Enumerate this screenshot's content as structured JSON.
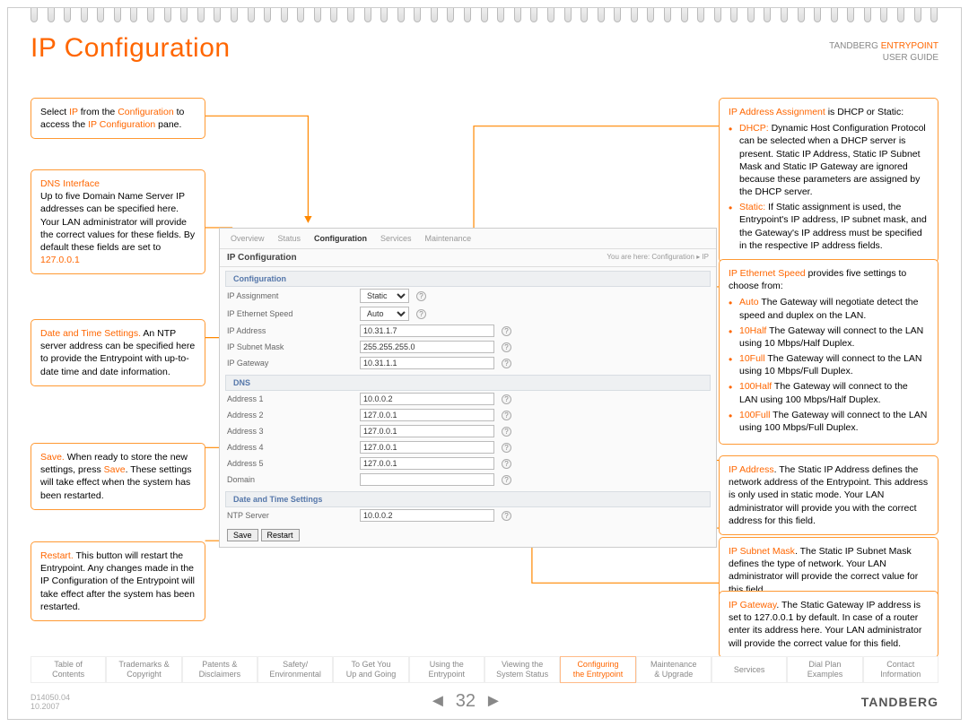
{
  "header": {
    "title": "IP Configuration",
    "brand_a": "TANDBERG",
    "brand_b": "ENTRYPOINT",
    "brand_c": "USER GUIDE"
  },
  "left1": {
    "t1": "Select ",
    "t2": "IP",
    "t3": " from the ",
    "t4": "Configuration",
    "t5": " to access the ",
    "t6": "IP Configuration",
    "t7": " pane."
  },
  "left2": {
    "h": "DNS Interface",
    "t": "Up to five Domain Name Server IP addresses can be specified here. Your LAN administrator will provide the correct values for these fields. By default these fields are set to ",
    "v": "127.0.0.1"
  },
  "left3": {
    "h": "Date and Time Settings.",
    "t": " An NTP server address can be specified here to provide the Entrypoint with up-to-date time and date information."
  },
  "left4": {
    "h": "Save.",
    "t1": " When ready to store the new settings, press ",
    "h2": "Save",
    "t2": ". These settings will take effect when the system has been restarted."
  },
  "left5": {
    "h": "Restart.",
    "t": " This button will restart the Entrypoint. Any changes made in the IP Configuration of the Entrypoint will take effect after the system has been restarted."
  },
  "right1": {
    "h": "IP Address Assignment",
    "t": " is DHCP or Static:",
    "li": [
      {
        "h": "DHCP:",
        "t": " Dynamic Host Configuration Protocol can be selected when a DHCP server is present. Static IP Address, Static IP Subnet Mask and Static IP Gateway are ignored because these parameters are assigned by the DHCP server."
      },
      {
        "h": "Static:",
        "t": " If Static assignment is used, the Entrypoint's IP address, IP subnet mask, and the Gateway's IP address must be specified in the respective IP address fields."
      }
    ]
  },
  "right2": {
    "h": "IP Ethernet Speed",
    "t": " provides five settings to choose from:",
    "li": [
      {
        "h": "Auto",
        "t": " The Gateway will negotiate detect the speed and duplex on the LAN."
      },
      {
        "h": "10Half",
        "t": " The Gateway will connect to the LAN using 10 Mbps/Half Duplex."
      },
      {
        "h": "10Full",
        "t": " The Gateway will connect to the LAN using 10 Mbps/Full Duplex."
      },
      {
        "h": "100Half",
        "t": " The Gateway will connect to the LAN using 100 Mbps/Half Duplex."
      },
      {
        "h": "100Full",
        "t": " The Gateway will connect to the LAN using 100 Mbps/Full Duplex."
      }
    ]
  },
  "right3": {
    "h": "IP Address",
    "t": ". The Static IP Address defines the network address of the Entrypoint. This address is only used in static mode. Your LAN administrator will provide you with the correct address for this field."
  },
  "right4": {
    "h": "IP Subnet Mask",
    "t": ". The Static IP Subnet Mask defines the type of network. Your LAN administrator will provide the correct value for this field."
  },
  "right5": {
    "h": "IP Gateway",
    "t": ". The Static Gateway IP address is set to 127.0.0.1 by default. In case of a router enter its address here. Your LAN administrator will provide the correct value for this field."
  },
  "shot": {
    "tabs": [
      "Overview",
      "Status",
      "Configuration",
      "Services",
      "Maintenance"
    ],
    "active": "Configuration",
    "pane_title": "IP Configuration",
    "breadcrumb": "You are here: Configuration ▸ IP",
    "sects": [
      {
        "title": "Configuration",
        "rows": [
          {
            "label": "IP Assignment",
            "type": "select",
            "value": "Static"
          },
          {
            "label": "IP Ethernet Speed",
            "type": "select",
            "value": "Auto"
          },
          {
            "label": "IP Address",
            "type": "text",
            "value": "10.31.1.7"
          },
          {
            "label": "IP Subnet Mask",
            "type": "text",
            "value": "255.255.255.0"
          },
          {
            "label": "IP Gateway",
            "type": "text",
            "value": "10.31.1.1"
          }
        ]
      },
      {
        "title": "DNS",
        "rows": [
          {
            "label": "Address 1",
            "type": "text",
            "value": "10.0.0.2"
          },
          {
            "label": "Address 2",
            "type": "text",
            "value": "127.0.0.1"
          },
          {
            "label": "Address 3",
            "type": "text",
            "value": "127.0.0.1"
          },
          {
            "label": "Address 4",
            "type": "text",
            "value": "127.0.0.1"
          },
          {
            "label": "Address 5",
            "type": "text",
            "value": "127.0.0.1"
          },
          {
            "label": "Domain",
            "type": "text",
            "value": ""
          }
        ]
      },
      {
        "title": "Date and Time Settings",
        "rows": [
          {
            "label": "NTP Server",
            "type": "text",
            "value": "10.0.0.2"
          }
        ]
      }
    ],
    "btns": [
      "Save",
      "Restart"
    ]
  },
  "toc": [
    {
      "a": "Table of",
      "b": "Contents"
    },
    {
      "a": "Trademarks &",
      "b": "Copyright"
    },
    {
      "a": "Patents &",
      "b": "Disclaimers"
    },
    {
      "a": "Safety/",
      "b": "Environmental"
    },
    {
      "a": "To Get You",
      "b": "Up and Going"
    },
    {
      "a": "Using the",
      "b": "Entrypoint"
    },
    {
      "a": "Viewing the",
      "b": "System Status"
    },
    {
      "a": "Configuring",
      "b": "the Entrypoint",
      "active": true
    },
    {
      "a": "Maintenance",
      "b": "& Upgrade"
    },
    {
      "a": "Services",
      "b": ""
    },
    {
      "a": "Dial Plan",
      "b": "Examples"
    },
    {
      "a": "Contact",
      "b": "Information"
    }
  ],
  "footer": {
    "doc": "D14050.04",
    "date": "10.2007",
    "page": "32",
    "logo": "TANDBERG"
  }
}
